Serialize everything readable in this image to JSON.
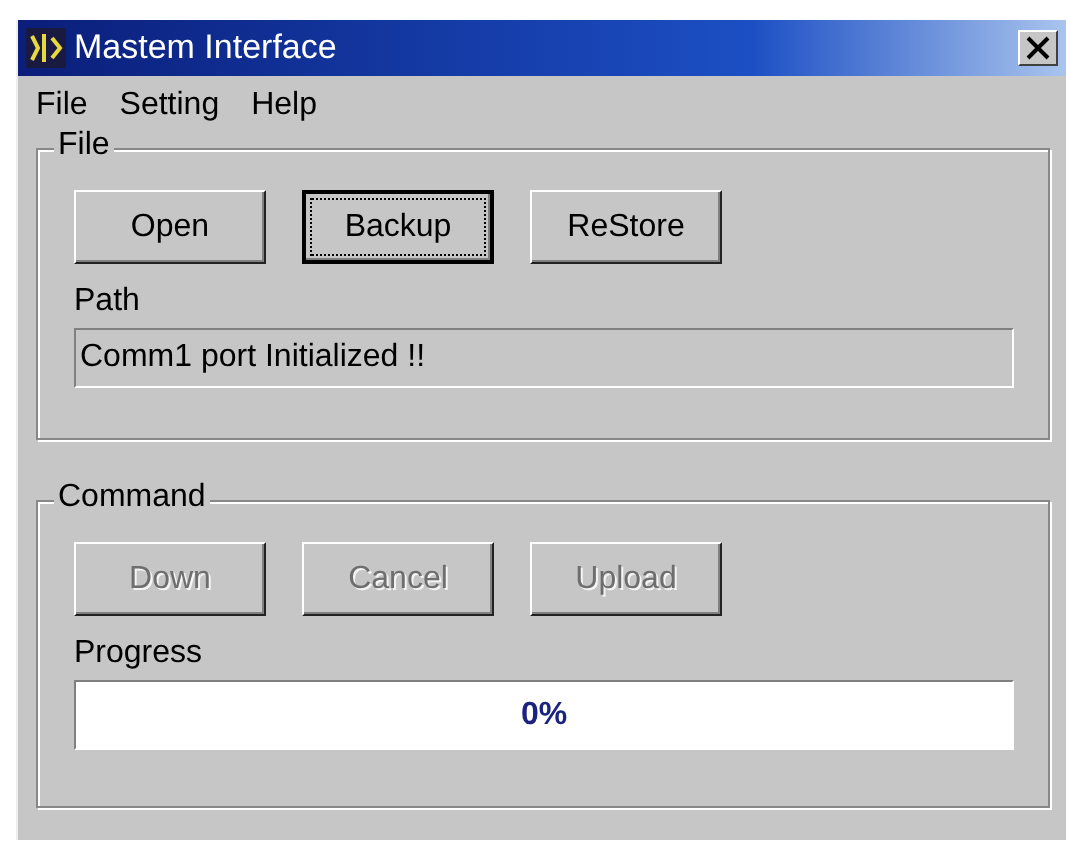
{
  "window": {
    "title": "Mastem Interface"
  },
  "menu": [
    {
      "label": "File"
    },
    {
      "label": "Setting"
    },
    {
      "label": "Help"
    }
  ],
  "file_group": {
    "title": "File",
    "buttons": [
      {
        "label": "Open",
        "focused": false,
        "disabled": false
      },
      {
        "label": "Backup",
        "focused": true,
        "disabled": false
      },
      {
        "label": "ReStore",
        "focused": false,
        "disabled": false
      }
    ],
    "path_label": "Path",
    "path_value": "Comm1 port Initialized !!"
  },
  "command_group": {
    "title": "Command",
    "buttons": [
      {
        "label": "Down",
        "focused": false,
        "disabled": true
      },
      {
        "label": "Cancel",
        "focused": false,
        "disabled": true
      },
      {
        "label": "Upload",
        "focused": false,
        "disabled": true
      }
    ],
    "progress_label": "Progress",
    "progress": {
      "level": 0,
      "reading": "0%"
    }
  }
}
